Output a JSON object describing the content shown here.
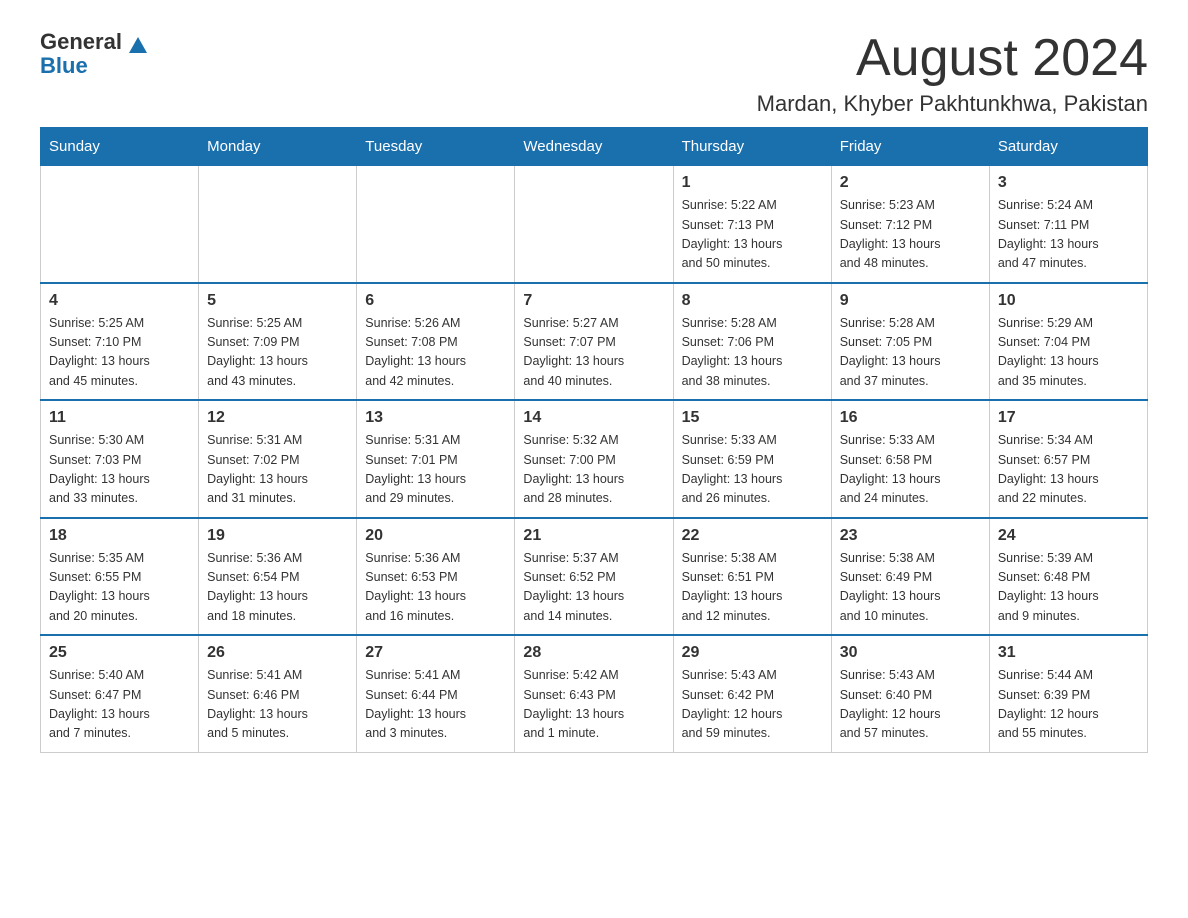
{
  "logo": {
    "text_general": "General",
    "text_blue": "Blue",
    "triangle_label": "logo-triangle"
  },
  "header": {
    "month_year": "August 2024",
    "location": "Mardan, Khyber Pakhtunkhwa, Pakistan"
  },
  "weekdays": [
    "Sunday",
    "Monday",
    "Tuesday",
    "Wednesday",
    "Thursday",
    "Friday",
    "Saturday"
  ],
  "weeks": [
    {
      "days": [
        {
          "num": "",
          "info": ""
        },
        {
          "num": "",
          "info": ""
        },
        {
          "num": "",
          "info": ""
        },
        {
          "num": "",
          "info": ""
        },
        {
          "num": "1",
          "info": "Sunrise: 5:22 AM\nSunset: 7:13 PM\nDaylight: 13 hours\nand 50 minutes."
        },
        {
          "num": "2",
          "info": "Sunrise: 5:23 AM\nSunset: 7:12 PM\nDaylight: 13 hours\nand 48 minutes."
        },
        {
          "num": "3",
          "info": "Sunrise: 5:24 AM\nSunset: 7:11 PM\nDaylight: 13 hours\nand 47 minutes."
        }
      ]
    },
    {
      "days": [
        {
          "num": "4",
          "info": "Sunrise: 5:25 AM\nSunset: 7:10 PM\nDaylight: 13 hours\nand 45 minutes."
        },
        {
          "num": "5",
          "info": "Sunrise: 5:25 AM\nSunset: 7:09 PM\nDaylight: 13 hours\nand 43 minutes."
        },
        {
          "num": "6",
          "info": "Sunrise: 5:26 AM\nSunset: 7:08 PM\nDaylight: 13 hours\nand 42 minutes."
        },
        {
          "num": "7",
          "info": "Sunrise: 5:27 AM\nSunset: 7:07 PM\nDaylight: 13 hours\nand 40 minutes."
        },
        {
          "num": "8",
          "info": "Sunrise: 5:28 AM\nSunset: 7:06 PM\nDaylight: 13 hours\nand 38 minutes."
        },
        {
          "num": "9",
          "info": "Sunrise: 5:28 AM\nSunset: 7:05 PM\nDaylight: 13 hours\nand 37 minutes."
        },
        {
          "num": "10",
          "info": "Sunrise: 5:29 AM\nSunset: 7:04 PM\nDaylight: 13 hours\nand 35 minutes."
        }
      ]
    },
    {
      "days": [
        {
          "num": "11",
          "info": "Sunrise: 5:30 AM\nSunset: 7:03 PM\nDaylight: 13 hours\nand 33 minutes."
        },
        {
          "num": "12",
          "info": "Sunrise: 5:31 AM\nSunset: 7:02 PM\nDaylight: 13 hours\nand 31 minutes."
        },
        {
          "num": "13",
          "info": "Sunrise: 5:31 AM\nSunset: 7:01 PM\nDaylight: 13 hours\nand 29 minutes."
        },
        {
          "num": "14",
          "info": "Sunrise: 5:32 AM\nSunset: 7:00 PM\nDaylight: 13 hours\nand 28 minutes."
        },
        {
          "num": "15",
          "info": "Sunrise: 5:33 AM\nSunset: 6:59 PM\nDaylight: 13 hours\nand 26 minutes."
        },
        {
          "num": "16",
          "info": "Sunrise: 5:33 AM\nSunset: 6:58 PM\nDaylight: 13 hours\nand 24 minutes."
        },
        {
          "num": "17",
          "info": "Sunrise: 5:34 AM\nSunset: 6:57 PM\nDaylight: 13 hours\nand 22 minutes."
        }
      ]
    },
    {
      "days": [
        {
          "num": "18",
          "info": "Sunrise: 5:35 AM\nSunset: 6:55 PM\nDaylight: 13 hours\nand 20 minutes."
        },
        {
          "num": "19",
          "info": "Sunrise: 5:36 AM\nSunset: 6:54 PM\nDaylight: 13 hours\nand 18 minutes."
        },
        {
          "num": "20",
          "info": "Sunrise: 5:36 AM\nSunset: 6:53 PM\nDaylight: 13 hours\nand 16 minutes."
        },
        {
          "num": "21",
          "info": "Sunrise: 5:37 AM\nSunset: 6:52 PM\nDaylight: 13 hours\nand 14 minutes."
        },
        {
          "num": "22",
          "info": "Sunrise: 5:38 AM\nSunset: 6:51 PM\nDaylight: 13 hours\nand 12 minutes."
        },
        {
          "num": "23",
          "info": "Sunrise: 5:38 AM\nSunset: 6:49 PM\nDaylight: 13 hours\nand 10 minutes."
        },
        {
          "num": "24",
          "info": "Sunrise: 5:39 AM\nSunset: 6:48 PM\nDaylight: 13 hours\nand 9 minutes."
        }
      ]
    },
    {
      "days": [
        {
          "num": "25",
          "info": "Sunrise: 5:40 AM\nSunset: 6:47 PM\nDaylight: 13 hours\nand 7 minutes."
        },
        {
          "num": "26",
          "info": "Sunrise: 5:41 AM\nSunset: 6:46 PM\nDaylight: 13 hours\nand 5 minutes."
        },
        {
          "num": "27",
          "info": "Sunrise: 5:41 AM\nSunset: 6:44 PM\nDaylight: 13 hours\nand 3 minutes."
        },
        {
          "num": "28",
          "info": "Sunrise: 5:42 AM\nSunset: 6:43 PM\nDaylight: 13 hours\nand 1 minute."
        },
        {
          "num": "29",
          "info": "Sunrise: 5:43 AM\nSunset: 6:42 PM\nDaylight: 12 hours\nand 59 minutes."
        },
        {
          "num": "30",
          "info": "Sunrise: 5:43 AM\nSunset: 6:40 PM\nDaylight: 12 hours\nand 57 minutes."
        },
        {
          "num": "31",
          "info": "Sunrise: 5:44 AM\nSunset: 6:39 PM\nDaylight: 12 hours\nand 55 minutes."
        }
      ]
    }
  ]
}
